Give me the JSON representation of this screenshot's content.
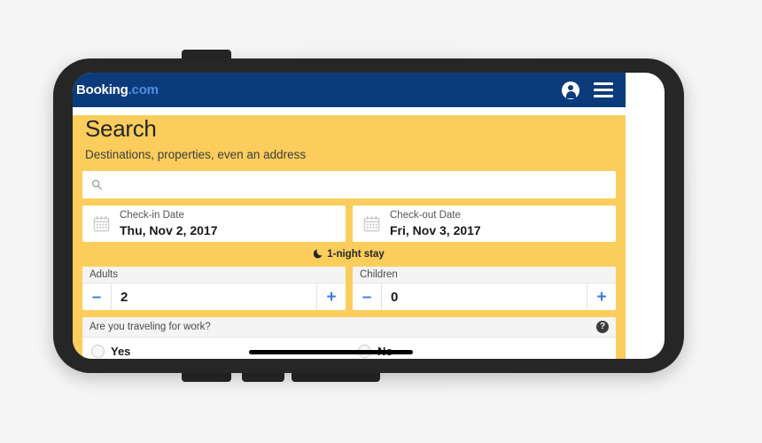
{
  "device": {
    "kind": "smartphone-landscape-mockup",
    "frame_color": "#262626",
    "screen_color": "#ffffff"
  },
  "app": {
    "brand": {
      "name": "Booking",
      "suffix": ".com",
      "header_color": "#0c3b7c",
      "suffix_color": "#4b8fe2",
      "body_color": "#fbcd5c"
    },
    "header": {
      "account_icon": "account-person-icon",
      "menu_icon": "hamburger-menu-icon"
    },
    "page_title": "Search",
    "subtitle": "Destinations, properties, even an address",
    "search": {
      "icon": "search-icon",
      "value": "",
      "placeholder": ""
    },
    "dates": {
      "checkin": {
        "icon": "calendar-icon",
        "label": "Check-in Date",
        "value": "Thu, Nov 2, 2017"
      },
      "checkout": {
        "icon": "calendar-icon",
        "label": "Check-out Date",
        "value": "Fri, Nov 3, 2017"
      },
      "stay_summary": "1-night stay",
      "stay_icon": "moon-icon"
    },
    "guests": [
      {
        "label": "Adults",
        "value": "2",
        "decrement": "–",
        "increment": "+",
        "accent": "#3b7edc"
      },
      {
        "label": "Children",
        "value": "0",
        "decrement": "–",
        "increment": "+",
        "accent": "#3b7edc"
      }
    ],
    "work_question": {
      "question": "Are you traveling for work?",
      "help_icon": "help-question-icon",
      "help_glyph": "?",
      "options": [
        {
          "label": "Yes",
          "selected": false
        },
        {
          "label": "No",
          "selected": false
        }
      ]
    }
  }
}
